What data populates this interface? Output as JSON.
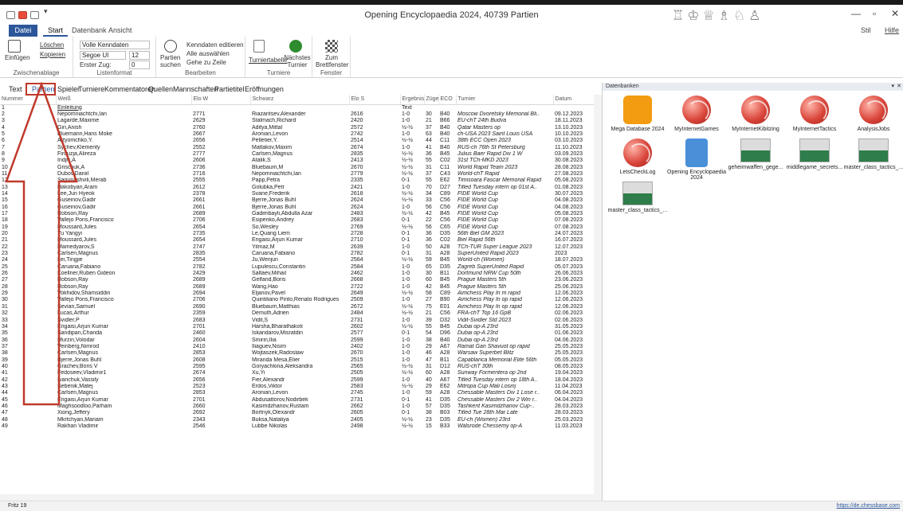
{
  "window": {
    "title": "Opening Encyclopaedia 2024, 40739 Partien"
  },
  "ribbon_tabs": [
    "Datei",
    "Start",
    "Datenbank",
    "Ansicht"
  ],
  "ribbon_right": {
    "style": "Stil",
    "help": "Hilfe"
  },
  "ribbon": {
    "clipboard": {
      "paste": "Einfügen",
      "delete": "Löschen",
      "copy": "Kopieren",
      "label": "Zwischenablage"
    },
    "listformat": {
      "font_sel": "Volle Kenndaten",
      "font": "Segoe UI",
      "size": "12",
      "first_move_label": "Erster Zug:",
      "first_move": "0",
      "label": "Listenformat"
    },
    "edit": {
      "search_games": "Partien suchen",
      "edit_keys": "Kenndaten editieren",
      "select_all": "Alle auswählen",
      "goto_row": "Gehe zu Zeile",
      "label": "Bearbeiten"
    },
    "tournament": {
      "table": "Turniertabelle",
      "next": "Nächstes Turnier",
      "label": "Turniere"
    },
    "window": {
      "board": "Zum Brettfenster",
      "label": "Fenster"
    }
  },
  "view_tabs": [
    "Text",
    "Partien",
    "Spieler",
    "Turniere",
    "Kommentatoren",
    "Quellen",
    "Mannschaften",
    "Partietitel",
    "Eröffnungen"
  ],
  "columns": [
    "Nummer",
    "Weiß",
    "Elo W",
    "Schwarz",
    "Elo S",
    "Ergebnis",
    "Züge",
    "ECO",
    "Turnier",
    "Datum"
  ],
  "rows": [
    [
      "1",
      "Einleitung",
      "",
      "",
      "",
      "Text",
      "",
      "",
      "",
      ""
    ],
    [
      "2",
      "Nepomniachtchi,Ian",
      "2771",
      "Riazantsev,Alexander",
      "2616",
      "1-0",
      "30",
      "B40",
      "Moscow Dvoretsky Memorial Bli..",
      "09.12.2023"
    ],
    [
      "3",
      "Lagarde,Maxime",
      "2629",
      "Stalmach,Richard",
      "2420",
      "1-0",
      "21",
      "B66",
      "EU-chT 24th Budva",
      "18.11.2023"
    ],
    [
      "4",
      "Giri,Anish",
      "2760",
      "Aditya,Mittal",
      "2572",
      "½-½",
      "37",
      "B40",
      "Qatar Masters op",
      "13.10.2023"
    ],
    [
      "5",
      "Bluemann,Hans Moke",
      "2667",
      "Aronian,Levon",
      "2742",
      "1-0",
      "63",
      "B40",
      "ch-USA 2023 Saint Louis USA",
      "10.10.2023"
    ],
    [
      "6",
      "Artyomchko,Y.",
      "2656",
      "Pelletier,Y.",
      "2514",
      "½-½",
      "44",
      "C11",
      "38th ECC Open 2023",
      "03.10.2023"
    ],
    [
      "7",
      "Sychev,Klementy",
      "2552",
      "Matlakov,Maxim",
      "2674",
      "1-0",
      "41",
      "B40",
      "RUS-ch 76th St Petersburg",
      "11.10.2023"
    ],
    [
      "8",
      "Firouzja,Alireza",
      "2777",
      "Carlsen,Magnus",
      "2835",
      "½-½",
      "36",
      "B45",
      "Julius Baer Rapid Div 1 W",
      "03.09.2023"
    ],
    [
      "9",
      "Indjic,A",
      "2606",
      "Atalik,S",
      "2413",
      "½-½",
      "55",
      "C02",
      "31st TCh-MKD 2023",
      "30.08.2023"
    ],
    [
      "10",
      "Grischuk,A",
      "2736",
      "Bluebaum,M",
      "2670",
      "½-½",
      "31",
      "C11",
      "World Rapid Team 2023",
      "28.08.2023"
    ],
    [
      "11",
      "Dubov,Daniil",
      "2716",
      "Nepomniachtchi,Ian",
      "2779",
      "½-½",
      "37",
      "C43",
      "World-chT Rapid",
      "27.08.2023"
    ],
    [
      "12",
      "Sagunashvili,Merab",
      "2555",
      "Papp,Petra",
      "2335",
      "0-1",
      "55",
      "E62",
      "Timisoara Fascar Memorial Rapid",
      "05.08.2023"
    ],
    [
      "13",
      "Hakobyan,Aram",
      "2612",
      "Golubka,Petr",
      "2421",
      "1-0",
      "70",
      "D27",
      "Titled Tuesday intern op 01st A..",
      "01.08.2023"
    ],
    [
      "14",
      "Lee,Jun Hyeok",
      "2378",
      "Svane,Frederik",
      "2618",
      "½-½",
      "34",
      "C89",
      "FIDE World Cup",
      "30.07.2023"
    ],
    [
      "15",
      "Guseinov,Gadir",
      "2661",
      "Bjerre,Jonas Buhl",
      "2624",
      "½-½",
      "33",
      "C56",
      "FIDE World Cup",
      "04.08.2023"
    ],
    [
      "16",
      "Guseinov,Gadir",
      "2661",
      "Bjerre,Jonas Buhl",
      "2624",
      "1-0",
      "56",
      "C56",
      "FIDE World Cup",
      "04.08.2023"
    ],
    [
      "17",
      "Robson,Ray",
      "2689",
      "Gadimbayli,Abdulla Azar",
      "2483",
      "½-½",
      "42",
      "B45",
      "FIDE World Cup",
      "05.08.2023"
    ],
    [
      "18",
      "Vallejo Pons,Francisco",
      "2706",
      "Esipenko,Andrey",
      "2683",
      "0-1",
      "22",
      "C56",
      "FIDE World Cup",
      "07.08.2023"
    ],
    [
      "19",
      "Moussard,Jules",
      "2654",
      "So,Wesley",
      "2769",
      "½-½",
      "56",
      "C65",
      "FIDE World Cup",
      "07.08.2023"
    ],
    [
      "20",
      "Yu Yangyi",
      "2735",
      "Le,Quang Liem",
      "2728",
      "0-1",
      "36",
      "D35",
      "56th Biel GM 2023",
      "24.07.2023"
    ],
    [
      "21",
      "Moussard,Jules",
      "2654",
      "Erigaisi,Arjun Kumar",
      "2710",
      "0-1",
      "36",
      "C02",
      "Biel Rapid 56th",
      "16.07.2023"
    ],
    [
      "22",
      "Mamedyarov,S",
      "2747",
      "Yilmaz,M",
      "2639",
      "1-0",
      "50",
      "A28",
      "TCh-TUR Super League 2023",
      "12.07.2023"
    ],
    [
      "23",
      "Carlsen,Magnus",
      "2835",
      "Caruana,Fabiano",
      "2782",
      "0-1",
      "31",
      "A28",
      "SuperUnited Rapid 2023",
      "2023"
    ],
    [
      "24",
      "Lei,Tingjie",
      "2554",
      "Ju,Wenjun",
      "2564",
      "½-½",
      "59",
      "B45",
      "World-ch (Women)",
      "18.07.2023"
    ],
    [
      "25",
      "Caruana,Fabiano",
      "2782",
      "Lupulescu,Constantin",
      "2584",
      "1-0",
      "65",
      "D35",
      "Zagreb SuperUnited Rapid",
      "05.07.2023"
    ],
    [
      "26",
      "Koellner,Ruben Gideon",
      "2429",
      "Saltaev,Mihail",
      "2462",
      "1-0",
      "30",
      "B11",
      "Dortmund NRW Cup 50th",
      "26.06.2023"
    ],
    [
      "27",
      "Robson,Ray",
      "2689",
      "Gelfand,Boris",
      "2668",
      "1-0",
      "60",
      "B45",
      "Prague Masters 5th",
      "23.06.2023"
    ],
    [
      "28",
      "Robson,Ray",
      "2689",
      "Wang,Hao",
      "2722",
      "1-0",
      "42",
      "B45",
      "Prague Masters 5th",
      "25.06.2023"
    ],
    [
      "29",
      "Vokhidov,Shamsiddin",
      "2694",
      "Eljanov,Pavel",
      "2649",
      "½-½",
      "58",
      "C89",
      "Aimchess Play In m rapid",
      "12.06.2023"
    ],
    [
      "30",
      "Vallejo Pons,Francisco",
      "2706",
      "Quintiliano Pinto,Renato Rodrigues",
      "2509",
      "1-0",
      "27",
      "B90",
      "Aimchess Play In op rapid",
      "12.06.2023"
    ],
    [
      "31",
      "Sevian,Samuel",
      "2690",
      "Bluebaum,Matthias",
      "2672",
      "½-½",
      "75",
      "E01",
      "Aimchess Play In op rapid",
      "12.06.2023"
    ],
    [
      "32",
      "Lucas,Arthur",
      "2359",
      "Demuth,Adrien",
      "2484",
      "½-½",
      "21",
      "C56",
      "FRA-chT Top 16 GpB",
      "02.06.2023"
    ],
    [
      "33",
      "Svidler,P",
      "2683",
      "Vidit,S",
      "2731",
      "1-0",
      "39",
      "D32",
      "Vidit-Svidler Std 2023",
      "02.06.2023"
    ],
    [
      "34",
      "Erigaisi,Arjun Kumar",
      "2701",
      "Harsha,Bharathakoti",
      "2602",
      "½-½",
      "55",
      "B45",
      "Dubai op-A 23rd",
      "31.05.2023"
    ],
    [
      "35",
      "Sandipan,Chanda",
      "2460",
      "Iskandarov,Misratdin",
      "2577",
      "0-1",
      "54",
      "D96",
      "Dubai op-A 23rd",
      "01.06.2023"
    ],
    [
      "36",
      "Murzin,Volodar",
      "2604",
      "Smirin,Ilia",
      "2599",
      "1-0",
      "38",
      "B40",
      "Dubai op-A 23rd",
      "04.06.2023"
    ],
    [
      "37",
      "Veinberg,Nimrod",
      "2410",
      "Iliaguev,Nisim",
      "2402",
      "1-0",
      "29",
      "A67",
      "Ramat Gan Shavuot op rapid",
      "25.05.2023"
    ],
    [
      "38",
      "Carlsen,Magnus",
      "2853",
      "Wojtaszek,Radoslaw",
      "2670",
      "1-0",
      "46",
      "A28",
      "Warsaw Superbet Blitz",
      "25.05.2023"
    ],
    [
      "39",
      "Bjerre,Jonas Buhl",
      "2608",
      "Miranda Mesa,Elier",
      "2515",
      "1-0",
      "47",
      "B11",
      "Capablanca Memorial Elite 56th",
      "05.05.2023"
    ],
    [
      "40",
      "Grachev,Boris V",
      "2595",
      "Goryachkina,Aleksandra",
      "2565",
      "½-½",
      "31",
      "D12",
      "RUS-chT 30th",
      "08.05.2023"
    ],
    [
      "41",
      "Fedoseev,Vladimir1",
      "2674",
      "Xu,Yi",
      "2505",
      "½-½",
      "60",
      "A28",
      "Sunway Formentera op 2nd",
      "19.04.2023"
    ],
    [
      "42",
      "Ivanchuk,Vassily",
      "2656",
      "Fier,Alexandr",
      "2599",
      "1-0",
      "40",
      "A67",
      "Titled Tuesday intern op 18th A..",
      "18.04.2023"
    ],
    [
      "43",
      "Sebenik,Matej",
      "2523",
      "Erdos,Viktor",
      "2583",
      "½-½",
      "29",
      "E62",
      "Mitropa Cup Mali Losinj",
      "11.04.2023"
    ],
    [
      "44",
      "Carlsen,Magnus",
      "2853",
      "Aronian,Levon",
      "2745",
      "1-0",
      "59",
      "A28",
      "Chessable Masters Div 1 Lose r..",
      "06.04.2023"
    ],
    [
      "45",
      "Erigaisi,Arjun Kumar",
      "2701",
      "Abdusattorov,Nodirbek",
      "2731",
      "0-1",
      "41",
      "D35",
      "Chessable Masters Div 2 Win r..",
      "04.04.2023"
    ],
    [
      "46",
      "Maghsoodloo,Parham",
      "2660",
      "Kasimdzhanov,Rustam",
      "2662",
      "1-0",
      "57",
      "D35",
      "Tashkent Kasimdzhanov Cup-..",
      "28.03.2023"
    ],
    [
      "47",
      "Xiong,Jeffery",
      "2692",
      "Bortnyk,Olexandr",
      "2605",
      "0-1",
      "38",
      "B03",
      "Titled Tue 28th Mar Late",
      "28.03.2023"
    ],
    [
      "48",
      "Mkrtchyan,Mariam",
      "2343",
      "Buksa,Nataliya",
      "2405",
      "½-½",
      "23",
      "D35",
      "EU-ch (Women) 23rd",
      "25.03.2023"
    ],
    [
      "49",
      "Rakhan Vladimir",
      "2546",
      "Lubbe Nikolas",
      "2498",
      "½-½",
      "15",
      "B33",
      "Walsrode Chessemy op-A",
      "11.03.2023"
    ]
  ],
  "dbpanel": {
    "title": "Datenbanken",
    "items": [
      {
        "name": "Mega Database 2024",
        "icon": "mega-database-icon"
      },
      {
        "name": "MyInternetGames",
        "icon": "chess-ball-icon"
      },
      {
        "name": "MyInternetKibitzing",
        "icon": "chess-ball-icon"
      },
      {
        "name": "MyInternetTactics",
        "icon": "chess-ball-icon"
      },
      {
        "name": "AnalysisJobs",
        "icon": "chess-ball-icon"
      },
      {
        "name": "LetsCheckLog",
        "icon": "chess-ball-icon"
      },
      {
        "name": "Opening Encyclopaedia 2024",
        "icon": "book-database-icon"
      },
      {
        "name": "geheimwaffen_gege...",
        "icon": "video-thumbnail-icon"
      },
      {
        "name": "middlegame_secrets...",
        "icon": "video-thumbnail-icon"
      },
      {
        "name": "master_class_tactics_...",
        "icon": "video-thumbnail-icon"
      },
      {
        "name": "master_class_tactics_...",
        "icon": "video-thumbnail-icon"
      }
    ]
  },
  "status": {
    "left": "Fritz 19",
    "right": "https://de.chessbase.com"
  },
  "colors": {
    "accent": "#2b579a",
    "annotation": "#c0392b"
  }
}
